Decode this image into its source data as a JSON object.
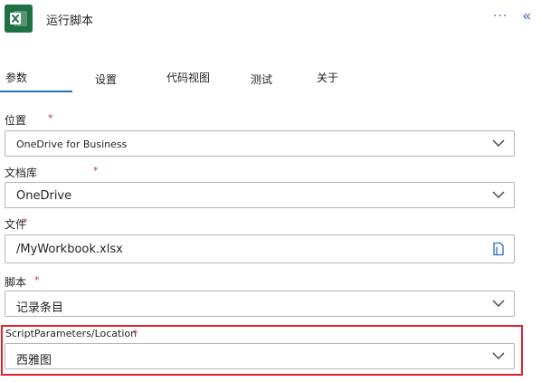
{
  "header": {
    "title": "运行脚本",
    "more": "···",
    "collapse": "«"
  },
  "tabs": [
    "参数",
    "设置",
    "代码视图",
    "测试",
    "关于"
  ],
  "fields": {
    "location": {
      "label": "位置",
      "required": "*",
      "value": "OneDrive for Business"
    },
    "library": {
      "label": "文档库",
      "required": "*",
      "value": "OneDrive"
    },
    "file": {
      "label": "文件",
      "required": "*",
      "value": "/MyWorkbook.xlsx"
    },
    "script": {
      "label": "脚本",
      "required": "*",
      "value": "记录条目"
    },
    "script_location": {
      "label": "ScriptParameters/Location",
      "required": "*",
      "value": "西雅图"
    }
  },
  "colors": {
    "accent": "#2b6cc4",
    "excel_green": "#1e7145",
    "required": "#c4314b",
    "highlight": "#e0242e"
  },
  "icons": {
    "app": "excel-icon",
    "dropdown": "chevron-down-icon",
    "file_picker": "folder-icon"
  }
}
